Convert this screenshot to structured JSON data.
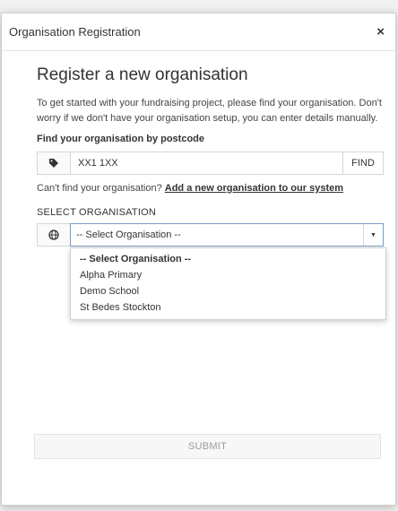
{
  "modal": {
    "title": "Organisation Registration",
    "close_label": "×"
  },
  "form": {
    "heading": "Register a new organisation",
    "intro": "To get started with your fundraising project, please find your organisation. Don't worry if we don't have your organisation setup, you can enter details manually.",
    "find_label": "Find your organisation by postcode",
    "postcode_value": "XX1 1XX",
    "find_button": "FIND",
    "cant_find_text": "Can't find your organisation?",
    "add_link": "Add a new organisation to our system",
    "select_label": "SELECT ORGANISATION",
    "select_value": "-- Select Organisation --",
    "options": [
      "-- Select Organisation --",
      "Alpha Primary",
      "Demo School",
      "St Bedes Stockton"
    ],
    "submit_button": "SUBMIT"
  },
  "icons": {
    "postcode": "tag-icon",
    "organisation": "globe-icon",
    "dropdown": "caret-down-icon"
  }
}
